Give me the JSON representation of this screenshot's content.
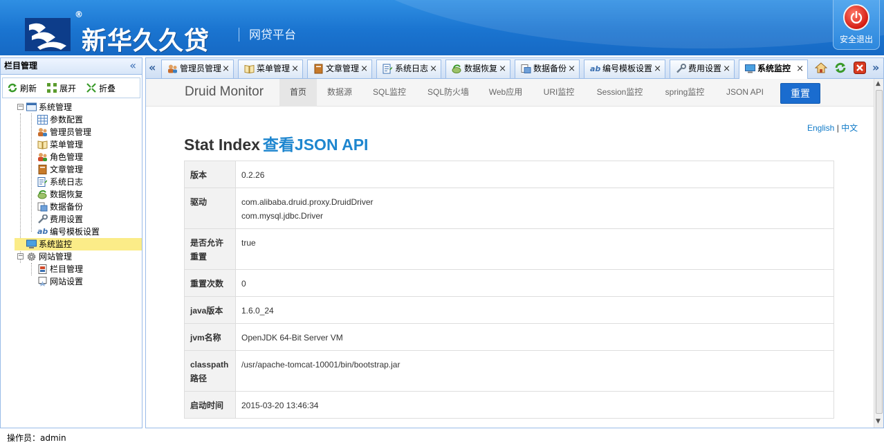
{
  "header": {
    "brand_name": "新华久久贷",
    "subtitle": "网贷平台",
    "registered_mark": "®",
    "logout_label": "安全退出"
  },
  "sidebar": {
    "title": "栏目管理",
    "toolbar": {
      "refresh": "刷新",
      "expand": "展开",
      "collapse": "折叠"
    },
    "tree": {
      "system": {
        "label": "系统管理",
        "children": [
          "参数配置",
          "管理员管理",
          "菜单管理",
          "角色管理",
          "文章管理",
          "系统日志",
          "数据恢复",
          "数据备份",
          "费用设置",
          "编号模板设置"
        ]
      },
      "monitor": {
        "label": "系统监控"
      },
      "site": {
        "label": "网站管理",
        "children": [
          "栏目管理",
          "网站设置"
        ]
      }
    }
  },
  "tabs": [
    {
      "label": "管理员管理",
      "icon": "admin-icon"
    },
    {
      "label": "菜单管理",
      "icon": "book-icon"
    },
    {
      "label": "文章管理",
      "icon": "article-icon"
    },
    {
      "label": "系统日志",
      "icon": "log-icon"
    },
    {
      "label": "数据恢复",
      "icon": "restore-icon"
    },
    {
      "label": "数据备份",
      "icon": "backup-icon"
    },
    {
      "label": "编号模板设置",
      "icon": "ab-icon"
    },
    {
      "label": "费用设置",
      "icon": "wrench-icon"
    },
    {
      "label": "系统监控",
      "icon": "monitor-icon",
      "active": true
    }
  ],
  "druid": {
    "brand": "Druid Monitor",
    "nav": [
      "首页",
      "数据源",
      "SQL监控",
      "SQL防火墙",
      "Web应用",
      "URI监控",
      "Session监控",
      "spring监控",
      "JSON API"
    ],
    "reset": "重置",
    "lang_en": "English",
    "lang_sep": "|",
    "lang_zh": "中文",
    "title": "Stat Index",
    "title_link": "查看JSON API",
    "rows": [
      {
        "key": "版本",
        "value": "0.2.26"
      },
      {
        "key": "驱动",
        "value": "com.alibaba.druid.proxy.DruidDriver",
        "value2": "com.mysql.jdbc.Driver"
      },
      {
        "key": "是否允许重置",
        "value": "true"
      },
      {
        "key": "重置次数",
        "value": "0"
      },
      {
        "key": "java版本",
        "value": "1.6.0_24"
      },
      {
        "key": "jvm名称",
        "value": "OpenJDK 64-Bit Server VM"
      },
      {
        "key": "classpath路径",
        "value": "/usr/apache-tomcat-10001/bin/bootstrap.jar"
      },
      {
        "key": "启动时间",
        "value": "2015-03-20 13:46:34"
      }
    ]
  },
  "status": {
    "operator": "操作员：admin"
  },
  "colors": {
    "header": "#1a74d0",
    "accent": "#1a6ccf",
    "link": "#1e86cf",
    "selected": "#fbec88"
  }
}
